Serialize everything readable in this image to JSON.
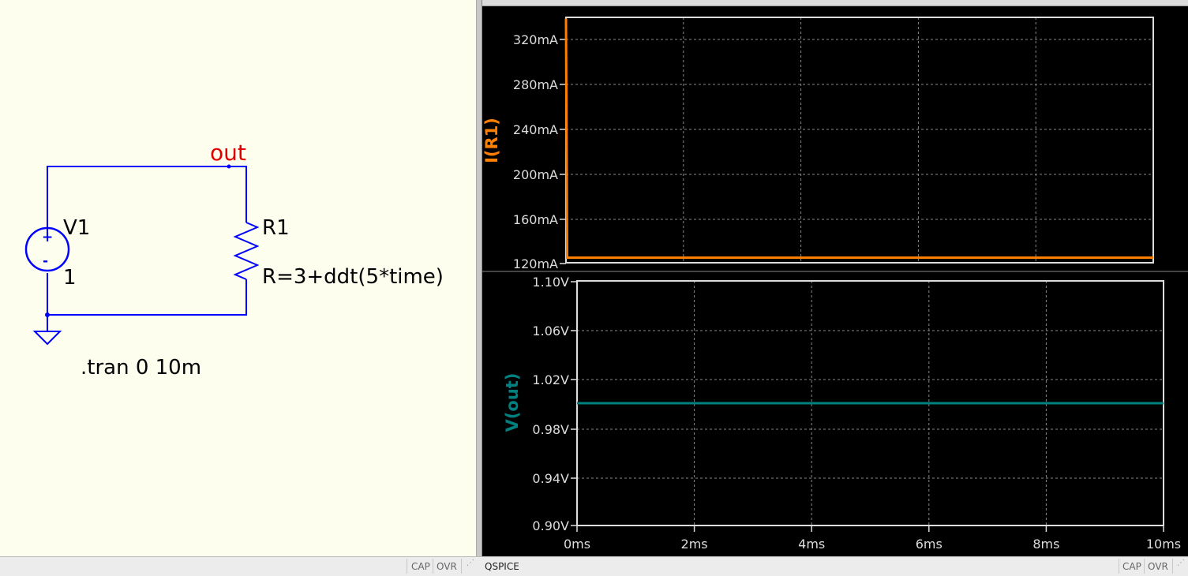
{
  "schematic": {
    "net_label": "out",
    "source_name": "V1",
    "source_value": "1",
    "resistor_name": "R1",
    "resistor_value": "R=3+ddt(5*time)",
    "directive": ".tran 0 10m",
    "colors": {
      "wire": "#0000ff",
      "net": "#e00000",
      "background": "#fefeee",
      "text": "#000000"
    }
  },
  "plots": [
    {
      "trace": "I(R1)",
      "color": "#ff8000",
      "y_ticks": [
        "320mA",
        "280mA",
        "240mA",
        "200mA",
        "160mA",
        "120mA"
      ],
      "y_range": [
        120,
        334
      ],
      "y_unit": "mA",
      "spike_peak": 333,
      "steady_value": 124.5
    },
    {
      "trace": "V(out)",
      "color": "#008080",
      "y_ticks": [
        "1.10V",
        "1.06V",
        "1.02V",
        "0.98V",
        "0.94V",
        "0.90V"
      ],
      "y_range": [
        0.9,
        1.1
      ],
      "y_unit": "V",
      "steady_value": 1.0
    }
  ],
  "x_axis": {
    "ticks": [
      "0ms",
      "2ms",
      "4ms",
      "6ms",
      "8ms",
      "10ms"
    ],
    "range": [
      0,
      10
    ],
    "unit": "ms"
  },
  "status_left": {
    "cap": "CAP",
    "ovr": "OVR"
  },
  "status_right": {
    "app": "QSPICE",
    "cap": "CAP",
    "ovr": "OVR"
  }
}
